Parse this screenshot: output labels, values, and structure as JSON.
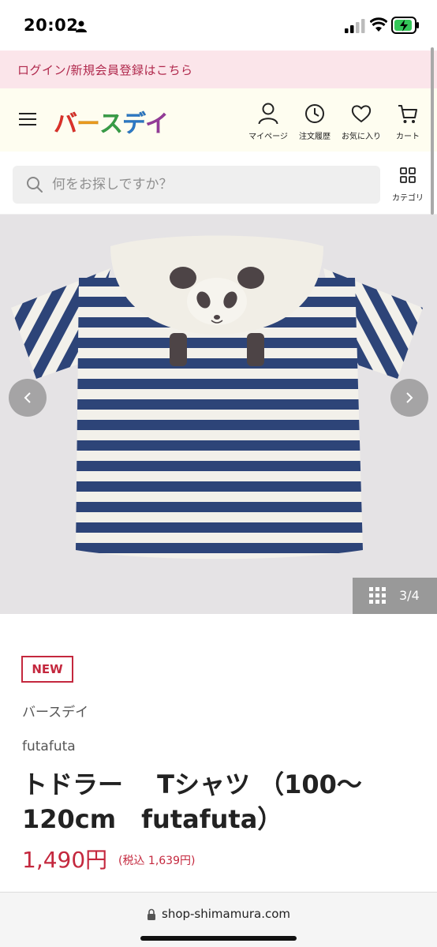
{
  "status_bar": {
    "time": "20:02"
  },
  "login_banner": {
    "text": "ログイン/新規会員登録はこちら"
  },
  "header": {
    "logo_chars": [
      "バ",
      "ー",
      "ス",
      "デ",
      "イ"
    ],
    "logo_colors": [
      "#e8332b",
      "#f4a11d",
      "#3aa54a",
      "#2e7fd0",
      "#9c3ea1"
    ],
    "nav": [
      {
        "label": "マイページ",
        "icon": "person-icon"
      },
      {
        "label": "注文履歴",
        "icon": "history-icon"
      },
      {
        "label": "お気に入り",
        "icon": "heart-icon"
      },
      {
        "label": "カート",
        "icon": "cart-icon"
      }
    ]
  },
  "search": {
    "placeholder": "何をお探しですか？",
    "category_label": "カテゴリ"
  },
  "gallery": {
    "counter": "3/4",
    "current": 3,
    "total": 4
  },
  "product": {
    "badge": "NEW",
    "brand": "バースデイ",
    "sub_brand": "futafuta",
    "title_line1": "トドラー　 Tシャツ （100〜",
    "title_line2": "120cm　futafuta）",
    "price": "1,490円",
    "tax_price": "(税込 1,639円)"
  },
  "url_bar": {
    "url": "shop-shimamura.com"
  },
  "colors": {
    "accent": "#c4283e",
    "banner_bg": "#fbe5ea",
    "header_bg": "#fefdf0"
  }
}
